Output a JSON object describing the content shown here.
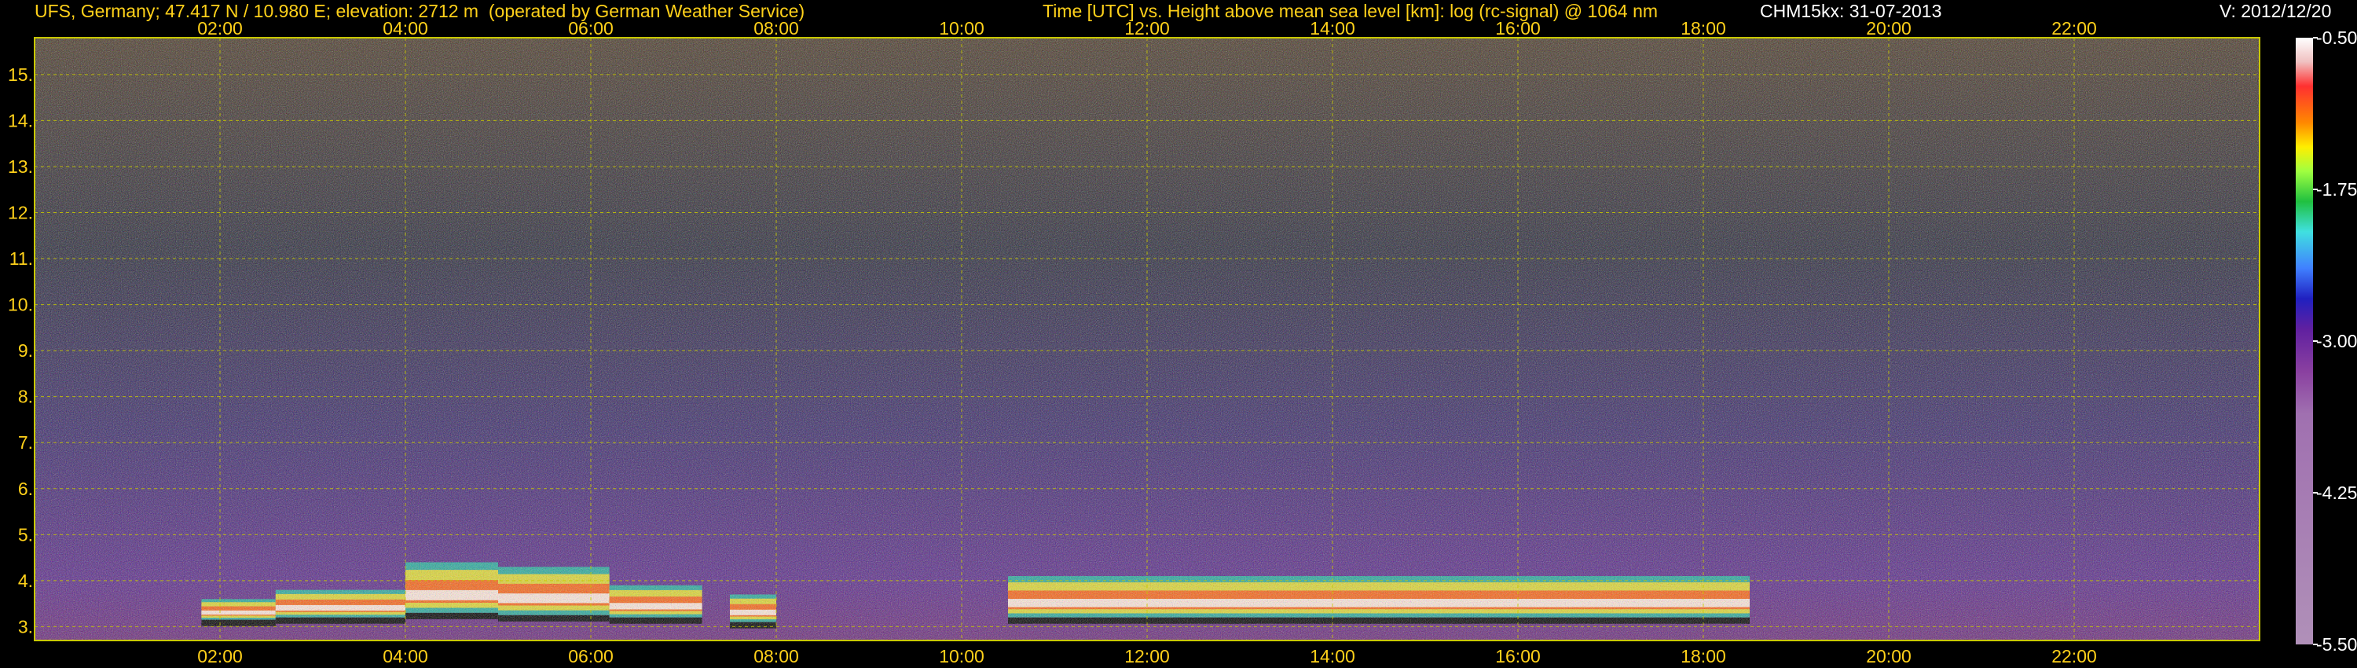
{
  "header": {
    "station": "UFS, Germany; 47.417 N / 10.980 E; elevation: 2712 m  (operated by German Weather Service)",
    "title": "Time [UTC] vs. Height above mean sea level [km]: log (rc-signal) @ 1064 nm",
    "instrument": "CHM15kx: 31-07-2013",
    "version": "V: 2012/12/20"
  },
  "colors": {
    "text": "#ffd11a",
    "grid": "#c8c800",
    "background": "#000000"
  },
  "chart_data": {
    "type": "heatmap",
    "title": "Time [UTC] vs. Height above mean sea level [km]: log (rc-signal) @ 1064 nm",
    "xlabel": "Time [UTC]",
    "ylabel": "Height above mean sea level [km]",
    "x_ticks": [
      "02:00",
      "04:00",
      "06:00",
      "08:00",
      "10:00",
      "12:00",
      "14:00",
      "16:00",
      "18:00",
      "20:00",
      "22:00"
    ],
    "x_tick_hours": [
      2,
      4,
      6,
      8,
      10,
      12,
      14,
      16,
      18,
      20,
      22
    ],
    "xlim_hours": [
      0,
      24
    ],
    "y_ticks": [
      "3.",
      "4.",
      "5.",
      "6.",
      "7.",
      "8.",
      "9.",
      "10.",
      "11.",
      "12.",
      "13.",
      "14.",
      "15."
    ],
    "y_tick_values": [
      3,
      4,
      5,
      6,
      7,
      8,
      9,
      10,
      11,
      12,
      13,
      14,
      15
    ],
    "ylim_km": [
      2.7,
      15.8
    ],
    "grid": true,
    "colorbar": {
      "ticks": [
        "-0.50",
        "-1.75",
        "-3.00",
        "-4.25",
        "-5.50"
      ],
      "tick_values": [
        -0.5,
        -1.75,
        -3.0,
        -4.25,
        -5.5
      ],
      "range": [
        -5.5,
        -0.5
      ],
      "scale": "log (rc-signal)"
    },
    "boundary_layer_bands": [
      {
        "start": 1.8,
        "end": 2.6,
        "base_km": 3.15,
        "top_km": 3.6
      },
      {
        "start": 2.6,
        "end": 4.0,
        "base_km": 3.2,
        "top_km": 3.8
      },
      {
        "start": 4.0,
        "end": 5.0,
        "base_km": 3.3,
        "top_km": 4.4
      },
      {
        "start": 5.0,
        "end": 6.2,
        "base_km": 3.25,
        "top_km": 4.3
      },
      {
        "start": 6.2,
        "end": 7.2,
        "base_km": 3.2,
        "top_km": 3.9
      },
      {
        "start": 7.5,
        "end": 8.0,
        "base_km": 3.1,
        "top_km": 3.7
      },
      {
        "start": 10.5,
        "end": 18.5,
        "base_km": 3.2,
        "top_km": 4.1
      }
    ]
  }
}
